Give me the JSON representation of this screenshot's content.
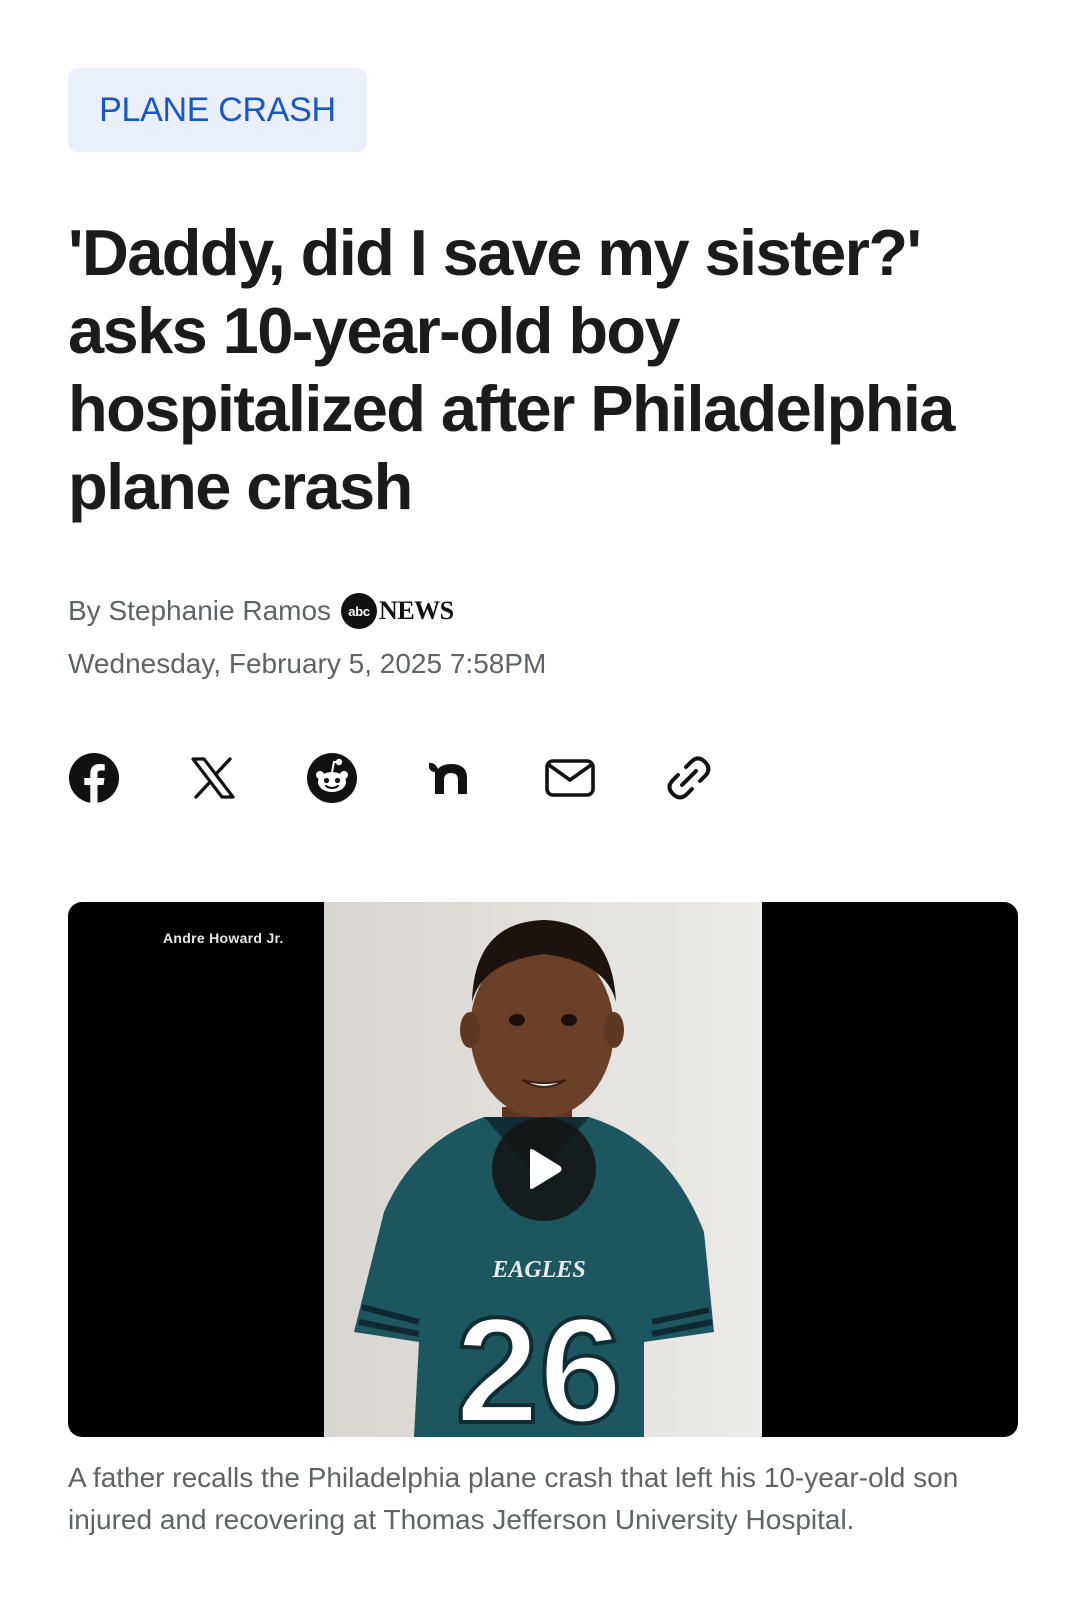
{
  "category": {
    "label": "PLANE CRASH"
  },
  "headline": "'Daddy, did I save my sister?' asks 10-year-old boy hospitalized after Philadelphia plane crash",
  "byline": {
    "prefix": "By Stephanie Ramos",
    "source_logo_abc": "abc",
    "source_logo_news": "NEWS"
  },
  "timestamp": "Wednesday, February 5, 2025 7:58PM",
  "share": {
    "icons": [
      "facebook-icon",
      "x-icon",
      "reddit-icon",
      "nextdoor-icon",
      "email-icon",
      "link-icon"
    ]
  },
  "video": {
    "credit": "Andre Howard Jr.",
    "jersey_text": "EAGLES",
    "jersey_number": "26",
    "play_icon": "play-icon"
  },
  "caption": "A father recalls the Philadelphia plane crash that left his 10-year-old son injured and recovering at Thomas Jefferson University Hospital.",
  "colors": {
    "accent": "#1a56c7",
    "pill_bg": "#e9f0fb",
    "meta_text": "#5f6368",
    "headline_text": "#1b1b1b",
    "jersey": "#1e5660"
  }
}
